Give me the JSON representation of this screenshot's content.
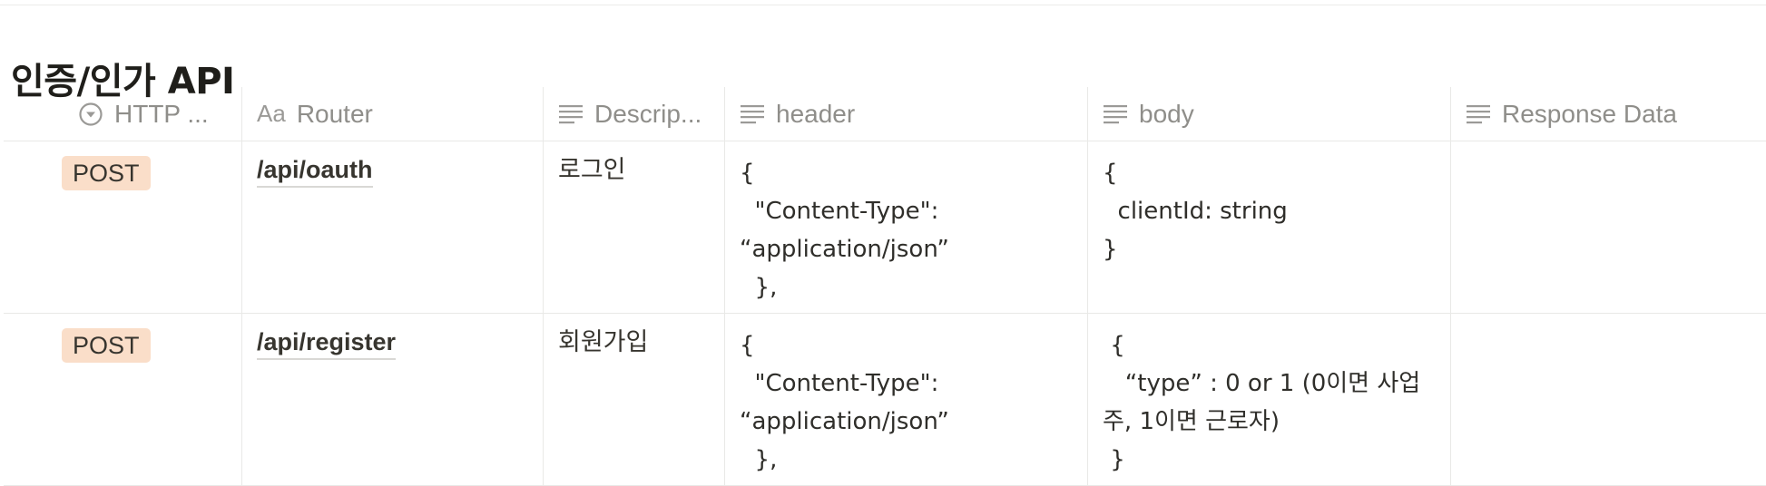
{
  "page": {
    "title": "인증/인가 API"
  },
  "table": {
    "columns": [
      {
        "label": "HTTP ...",
        "icon": "select-icon"
      },
      {
        "label": "Router",
        "icon": "title-icon"
      },
      {
        "label": "Descrip...",
        "icon": "text-lines-icon"
      },
      {
        "label": "header",
        "icon": "text-lines-icon"
      },
      {
        "label": "body",
        "icon": "text-lines-icon"
      },
      {
        "label": "Response Data",
        "icon": "text-lines-icon"
      }
    ],
    "rows": [
      {
        "method": "POST",
        "router": "/api/oauth",
        "description": "로그인",
        "header": "{\n  \"Content-Type\": “application/json”\n  },",
        "body": "{\n  clientId: string\n}",
        "response": ""
      },
      {
        "method": "POST",
        "router": "/api/register",
        "description": "회원가입",
        "header": "{\n  \"Content-Type\": “application/json”\n  },",
        "body": " {\n   “type” : 0 or 1 (0이면 사업주, 1이면 근로자)\n }",
        "response": ""
      }
    ]
  },
  "colors": {
    "badge_bg": "#fadec9",
    "border": "#e9e9e7",
    "header_text": "#8f8e8a"
  }
}
